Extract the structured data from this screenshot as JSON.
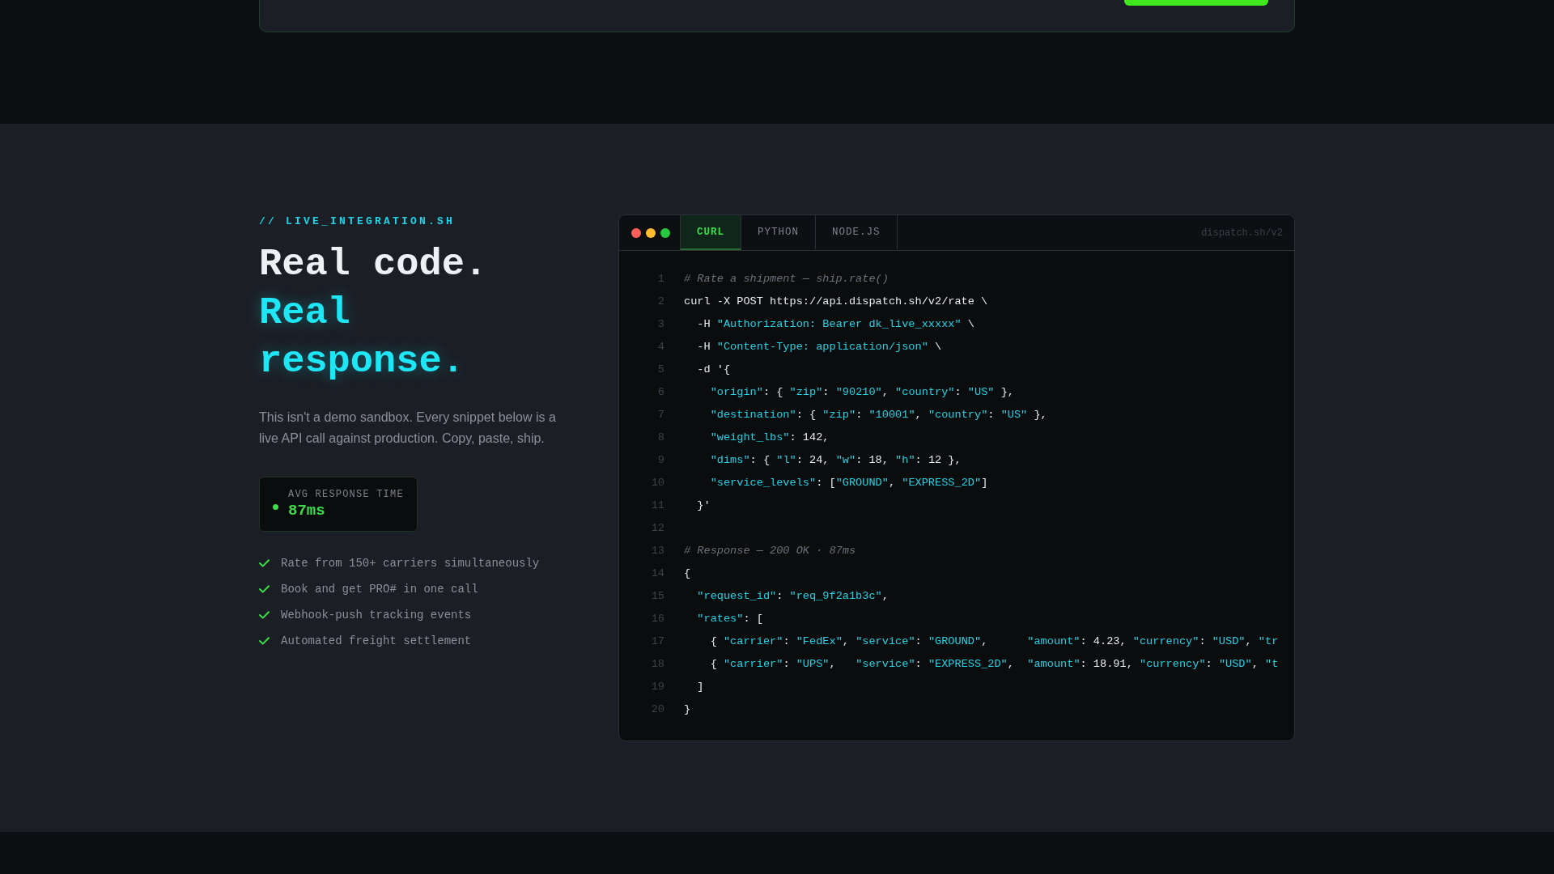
{
  "cta_card": {
    "button": {
      "kind": "primary"
    }
  },
  "section": {
    "eyebrow": "// LIVE_INTEGRATION.SH",
    "heading": {
      "plain": "Real code.",
      "accent": "Real response."
    },
    "description": "This isn't a demo sandbox. Every snippet below is a live API call against production. Copy, paste, ship.",
    "stat": {
      "label": "AVG RESPONSE TIME",
      "value": "87ms"
    },
    "features": [
      "Rate from 150+ carriers simultaneously",
      "Book and get PRO# in one call",
      "Webhook-push tracking events",
      "Automated freight settlement"
    ]
  },
  "code_window": {
    "tabs": [
      {
        "label": "CURL",
        "selected": true
      },
      {
        "label": "PYTHON",
        "selected": false
      },
      {
        "label": "NODE.JS",
        "selected": false
      }
    ],
    "url": "dispatch.sh/v2",
    "lines": [
      {
        "num": "1",
        "tokens": [
          {
            "kind": "comment",
            "text": "# Rate a shipment — ship.rate()"
          }
        ]
      },
      {
        "num": "2",
        "tokens": [
          {
            "kind": "plain",
            "text": "curl -X POST https://api.dispatch.sh/v2/rate \\"
          }
        ]
      },
      {
        "num": "3",
        "tokens": [
          {
            "kind": "plain",
            "text": "  -H "
          },
          {
            "kind": "string",
            "text": "\"Authorization: Bearer dk_live_xxxxx\""
          },
          {
            "kind": "plain",
            "text": " \\"
          }
        ]
      },
      {
        "num": "4",
        "tokens": [
          {
            "kind": "plain",
            "text": "  -H "
          },
          {
            "kind": "string",
            "text": "\"Content-Type: application/json\""
          },
          {
            "kind": "plain",
            "text": " \\"
          }
        ]
      },
      {
        "num": "5",
        "tokens": [
          {
            "kind": "plain",
            "text": "  -d '{"
          }
        ]
      },
      {
        "num": "6",
        "tokens": [
          {
            "kind": "string",
            "text": "    \"origin\""
          },
          {
            "kind": "plain",
            "text": ": { "
          },
          {
            "kind": "string",
            "text": "\"zip\""
          },
          {
            "kind": "plain",
            "text": ": "
          },
          {
            "kind": "string",
            "text": "\"90210\""
          },
          {
            "kind": "plain",
            "text": ", "
          },
          {
            "kind": "string",
            "text": "\"country\""
          },
          {
            "kind": "plain",
            "text": ": "
          },
          {
            "kind": "string",
            "text": "\"US\""
          },
          {
            "kind": "plain",
            "text": " },"
          }
        ]
      },
      {
        "num": "7",
        "tokens": [
          {
            "kind": "string",
            "text": "    \"destination\""
          },
          {
            "kind": "plain",
            "text": ": { "
          },
          {
            "kind": "string",
            "text": "\"zip\""
          },
          {
            "kind": "plain",
            "text": ": "
          },
          {
            "kind": "string",
            "text": "\"10001\""
          },
          {
            "kind": "plain",
            "text": ", "
          },
          {
            "kind": "string",
            "text": "\"country\""
          },
          {
            "kind": "plain",
            "text": ": "
          },
          {
            "kind": "string",
            "text": "\"US\""
          },
          {
            "kind": "plain",
            "text": " },"
          }
        ]
      },
      {
        "num": "8",
        "tokens": [
          {
            "kind": "string",
            "text": "    \"weight_lbs\""
          },
          {
            "kind": "plain",
            "text": ": 142,"
          }
        ]
      },
      {
        "num": "9",
        "tokens": [
          {
            "kind": "string",
            "text": "    \"dims\""
          },
          {
            "kind": "plain",
            "text": ": { "
          },
          {
            "kind": "string",
            "text": "\"l\""
          },
          {
            "kind": "plain",
            "text": ": 24, "
          },
          {
            "kind": "string",
            "text": "\"w\""
          },
          {
            "kind": "plain",
            "text": ": 18, "
          },
          {
            "kind": "string",
            "text": "\"h\""
          },
          {
            "kind": "plain",
            "text": ": 12 },"
          }
        ]
      },
      {
        "num": "10",
        "tokens": [
          {
            "kind": "string",
            "text": "    \"service_levels\""
          },
          {
            "kind": "plain",
            "text": ": ["
          },
          {
            "kind": "string",
            "text": "\"GROUND\""
          },
          {
            "kind": "plain",
            "text": ", "
          },
          {
            "kind": "string",
            "text": "\"EXPRESS_2D\""
          },
          {
            "kind": "plain",
            "text": "]"
          }
        ]
      },
      {
        "num": "11",
        "tokens": [
          {
            "kind": "plain",
            "text": "  }'"
          }
        ]
      },
      {
        "num": "12"
      },
      {
        "num": "13",
        "tokens": [
          {
            "kind": "comment",
            "text": "# Response — 200 OK · 87ms"
          }
        ]
      },
      {
        "num": "14",
        "tokens": [
          {
            "kind": "plain",
            "text": "{"
          }
        ]
      },
      {
        "num": "15",
        "tokens": [
          {
            "kind": "string",
            "text": "  \"request_id\""
          },
          {
            "kind": "plain",
            "text": ": "
          },
          {
            "kind": "string",
            "text": "\"req_9f2a1b3c\""
          },
          {
            "kind": "plain",
            "text": ","
          }
        ]
      },
      {
        "num": "16",
        "tokens": [
          {
            "kind": "string",
            "text": "  \"rates\""
          },
          {
            "kind": "plain",
            "text": ": ["
          }
        ]
      },
      {
        "num": "17",
        "tokens": [
          {
            "kind": "plain",
            "text": "    { "
          },
          {
            "kind": "string",
            "text": "\"carrier\""
          },
          {
            "kind": "plain",
            "text": ": "
          },
          {
            "kind": "string",
            "text": "\"FedEx\""
          },
          {
            "kind": "plain",
            "text": ", "
          },
          {
            "kind": "string",
            "text": "\"service\""
          },
          {
            "kind": "plain",
            "text": ": "
          },
          {
            "kind": "string",
            "text": "\"GROUND\""
          },
          {
            "kind": "plain",
            "text": ",      "
          },
          {
            "kind": "string",
            "text": "\"amount\""
          },
          {
            "kind": "plain",
            "text": ": 4.23, "
          },
          {
            "kind": "string",
            "text": "\"currency\""
          },
          {
            "kind": "plain",
            "text": ": "
          },
          {
            "kind": "string",
            "text": "\"USD\""
          },
          {
            "kind": "plain",
            "text": ", "
          },
          {
            "kind": "string",
            "text": "\"tr"
          }
        ]
      },
      {
        "num": "18",
        "tokens": [
          {
            "kind": "plain",
            "text": "    { "
          },
          {
            "kind": "string",
            "text": "\"carrier\""
          },
          {
            "kind": "plain",
            "text": ": "
          },
          {
            "kind": "string",
            "text": "\"UPS\""
          },
          {
            "kind": "plain",
            "text": ",   "
          },
          {
            "kind": "string",
            "text": "\"service\""
          },
          {
            "kind": "plain",
            "text": ": "
          },
          {
            "kind": "string",
            "text": "\"EXPRESS_2D\""
          },
          {
            "kind": "plain",
            "text": ",  "
          },
          {
            "kind": "string",
            "text": "\"amount\""
          },
          {
            "kind": "plain",
            "text": ": 18.91, "
          },
          {
            "kind": "string",
            "text": "\"currency\""
          },
          {
            "kind": "plain",
            "text": ": "
          },
          {
            "kind": "string",
            "text": "\"USD\""
          },
          {
            "kind": "plain",
            "text": ", "
          },
          {
            "kind": "string",
            "text": "\"t"
          }
        ]
      },
      {
        "num": "19",
        "tokens": [
          {
            "kind": "plain",
            "text": "  ]"
          }
        ]
      },
      {
        "num": "20",
        "tokens": [
          {
            "kind": "plain",
            "text": "}"
          }
        ]
      }
    ]
  }
}
